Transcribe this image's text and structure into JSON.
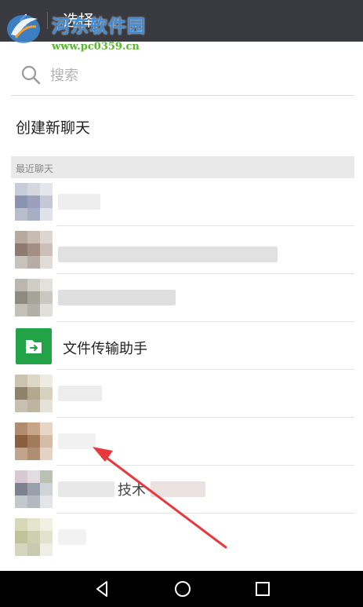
{
  "header": {
    "title": "选择",
    "back_icon": "back-arrow-icon"
  },
  "watermark": {
    "name": "河东软件园",
    "url": "www.pc0359.cn",
    "colors": {
      "name": "#3e8bd8",
      "url": "#58b62f"
    }
  },
  "search": {
    "placeholder": "搜索",
    "value": ""
  },
  "new_chat": {
    "label": "创建新聊天"
  },
  "recent": {
    "header": "最近聊天",
    "items": [
      {
        "name": ""
      },
      {
        "name": ""
      },
      {
        "name": ""
      },
      {
        "name": "文件传输助手"
      },
      {
        "name": ""
      },
      {
        "name": ""
      },
      {
        "name": "技术"
      },
      {
        "name": ""
      }
    ]
  },
  "nav": {
    "icons": [
      "nav-back-icon",
      "nav-home-icon",
      "nav-recents-icon"
    ]
  },
  "colors": {
    "topbar": "#393a3f",
    "file_transfer": "#22a347",
    "annotation_arrow": "#e8383c"
  }
}
